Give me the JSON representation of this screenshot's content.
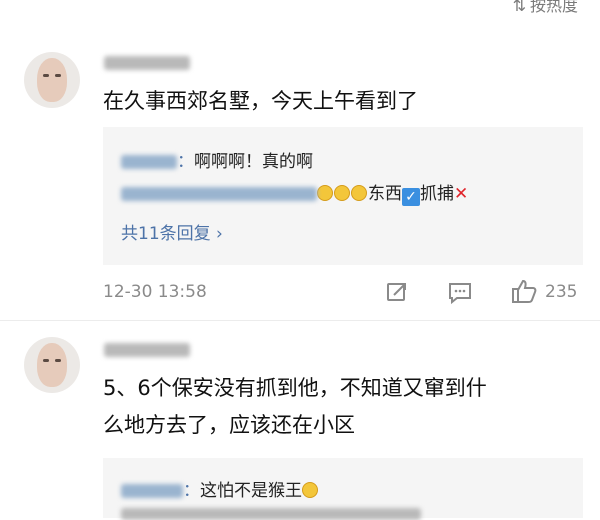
{
  "sort": {
    "glyph": "⇅",
    "label": "按热度"
  },
  "comments": [
    {
      "username_blurred": "",
      "content_lines": [
        "在久事西郊名墅，今天上午看到了"
      ],
      "replies": [
        {
          "text": "啊啊啊！真的啊"
        },
        {
          "text_a": "东西",
          "text_b": "抓捕"
        }
      ],
      "more_replies": "共11条回复 ›",
      "timestamp": "12-30 13:58",
      "like_count": "235"
    },
    {
      "username_blurred": "",
      "content_lines": [
        "5、6个保安没有抓到他，不知道又窜到什",
        "么地方去了，应该还在小区"
      ],
      "replies": [
        {
          "text": "这怕不是猴王"
        }
      ]
    }
  ]
}
